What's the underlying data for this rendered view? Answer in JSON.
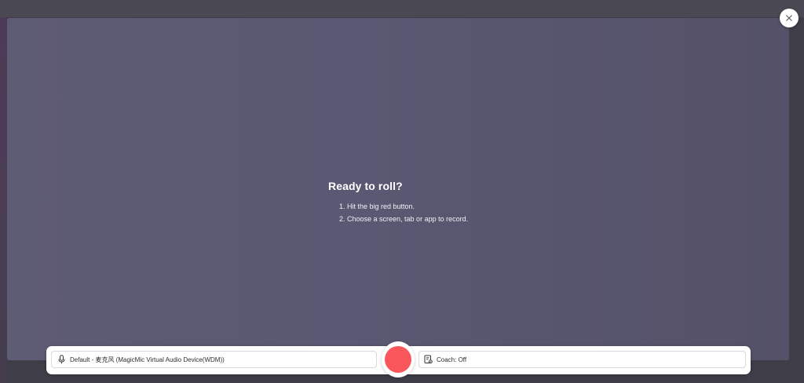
{
  "prompt": {
    "title": "Ready to roll?",
    "steps": [
      "1. Hit the big red button.",
      "2. Choose a screen, tab or app to record."
    ]
  },
  "toolbar": {
    "microphone_label": "Default - 麦克风 (MagicMic Virtual Audio Device(WDM))",
    "coach_label": "Coach: Off"
  },
  "icons": {
    "close": "close-icon",
    "microphone": "microphone-icon",
    "coach": "coach-icon"
  },
  "colors": {
    "record": "#f9575c",
    "stage": "#5a5872"
  }
}
